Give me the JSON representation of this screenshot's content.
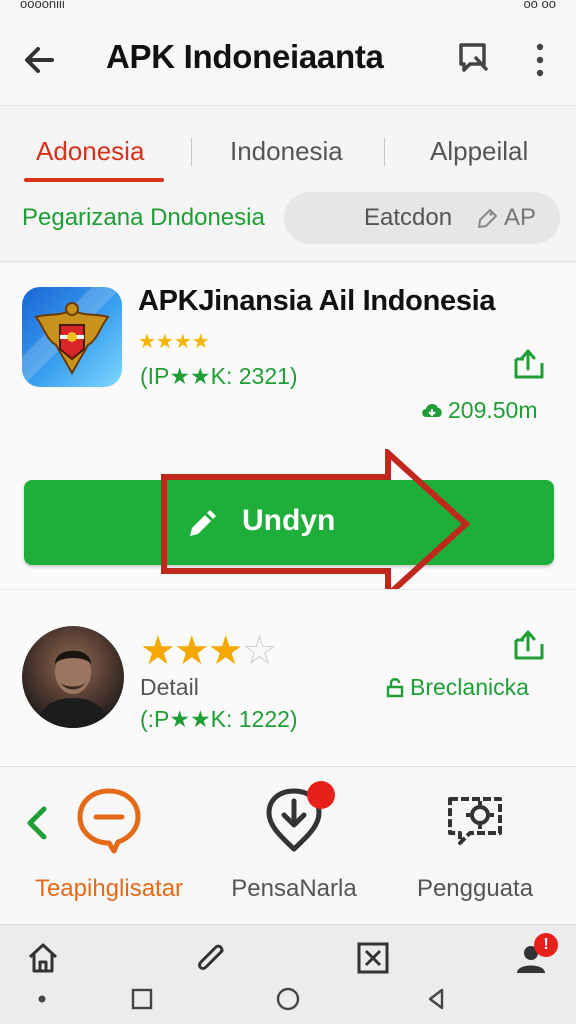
{
  "status_bar": {
    "left": "ooooniii",
    "right": "oo oo"
  },
  "app_bar": {
    "title": "APK Indoneiaanta"
  },
  "tabs": [
    {
      "label": "Adonesia",
      "active": true
    },
    {
      "label": "Indonesia",
      "active": false
    },
    {
      "label": "Alppeilal",
      "active": false
    }
  ],
  "filter": {
    "label": "Pegarizana Dndonesia",
    "pill_text": "Eatcdon",
    "pill_tag": "AP"
  },
  "app": {
    "name": "APKJinansia Ail Indonesia",
    "rating_stars": 4,
    "count_text": "(IP★★K: 2321)",
    "size_text": "209.50m"
  },
  "download_button": {
    "label": "Undyn"
  },
  "review": {
    "rating_stars": 3,
    "max_stars": 4,
    "detail_label": "Detail",
    "count_text": "(:P★★K: 1222)",
    "link_text": "Breclanicka"
  },
  "actions": [
    {
      "label": "Teapihglisatar",
      "icon": "minus-bubble-icon"
    },
    {
      "label": "PensaNarla",
      "icon": "download-pin-icon"
    },
    {
      "label": "Pengguata",
      "icon": "settings-chat-icon"
    }
  ],
  "nav_badge": "!",
  "colors": {
    "accent_red": "#d9301a",
    "green": "#1fae3a",
    "text_green": "#1e9e34",
    "orange": "#e46a18",
    "star": "#f4b400"
  }
}
